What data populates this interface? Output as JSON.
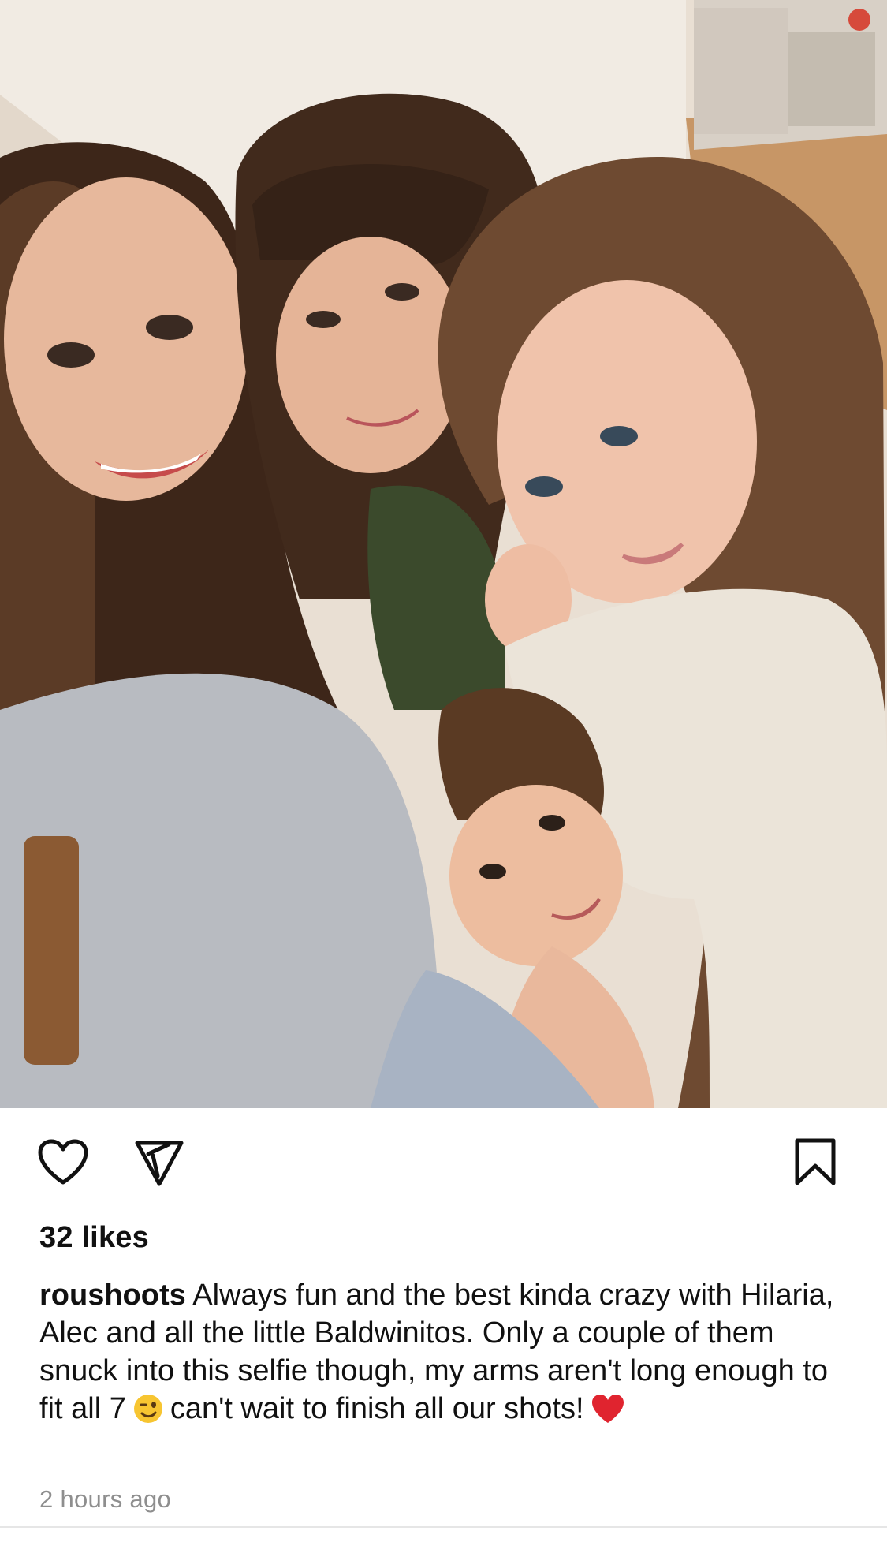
{
  "post": {
    "photo": {
      "description_icon": "selfie-photo",
      "palette": {
        "wall": "#efe8df",
        "floor": "#c89a69",
        "hair_dark": "#3b2418",
        "hair_light": "#6f4a2e",
        "skin": "#e9b99c",
        "sweater_gray": "#b9bcc2",
        "sweater_cream": "#ece6dc"
      }
    },
    "actions": {
      "like_icon": "heart-icon",
      "share_icon": "send-icon",
      "save_icon": "bookmark-icon"
    },
    "likes_text": "32 likes",
    "caption": {
      "username": "roushoots",
      "text_part1": " Always fun and the best kinda crazy with Hilaria, Alec and all the little Baldwinitos. Only a couple of them snuck into this selfie though, my arms aren't long enough to fit all 7",
      "text_part2": "can't wait to finish all our shots!",
      "emoji_wink": "😉",
      "emoji_heart": "❤"
    },
    "timestamp": "2 hours ago",
    "colors": {
      "text": "#111111",
      "muted": "#8e8e8e",
      "heart_red": "#e0242f",
      "wink_yellow": "#f7c531"
    }
  }
}
